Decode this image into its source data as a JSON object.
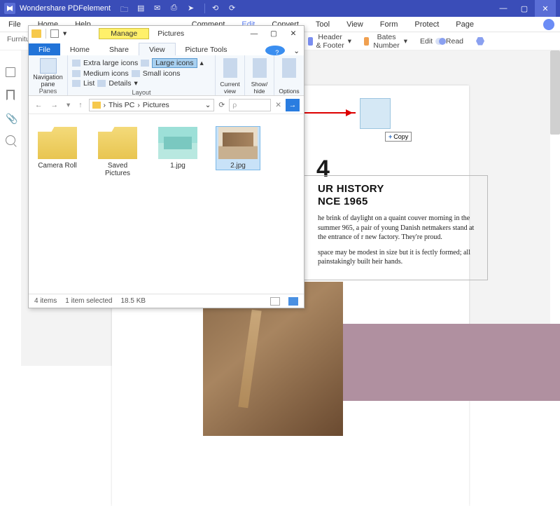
{
  "app": {
    "title": "Wondershare PDFelement"
  },
  "menus": [
    "File",
    "Home",
    "Help",
    "Comment",
    "Edit",
    "Convert",
    "Tool",
    "View",
    "Form",
    "Protect",
    "Page"
  ],
  "subbar": {
    "header_footer": "Header & Footer",
    "bates": "Bates Number",
    "edit": "Edit",
    "read": "Read"
  },
  "doc_tab": "Furniture (",
  "page": {
    "big_digit": "4",
    "headline_l1": "UR HISTORY",
    "headline_l2": "NCE 1965",
    "para1": "he brink of daylight on a quaint couver morning in the summer 965, a pair of young Danish netmakers stand at the entrance of r new factory. They're proud.",
    "para2": "space may be modest in size but it is fectly formed; all painstakingly built heir hands.",
    "copy_tag": "Copy"
  },
  "explorer": {
    "manage_tab": "Manage",
    "crumb_top": "Pictures",
    "ribbon_tabs": {
      "file": "File",
      "home": "Home",
      "share": "Share",
      "view": "View",
      "picture_tools": "Picture Tools"
    },
    "ribbon": {
      "nav_pane": "Navigation pane",
      "panes": "Panes",
      "xl_icons": "Extra large icons",
      "lg_icons": "Large icons",
      "md_icons": "Medium icons",
      "sm_icons": "Small icons",
      "list": "List",
      "details": "Details",
      "layout": "Layout",
      "current_view": "Current view",
      "show_hide": "Show/ hide",
      "options": "Options"
    },
    "path": {
      "root": "This PC",
      "folder": "Pictures"
    },
    "search_placeholder": "ρ",
    "items": [
      {
        "name": "Camera Roll"
      },
      {
        "name": "Saved Pictures"
      },
      {
        "name": "1.jpg"
      },
      {
        "name": "2.jpg"
      }
    ],
    "status": {
      "count": "4 items",
      "selected": "1 item selected",
      "size": "18.5 KB"
    }
  }
}
